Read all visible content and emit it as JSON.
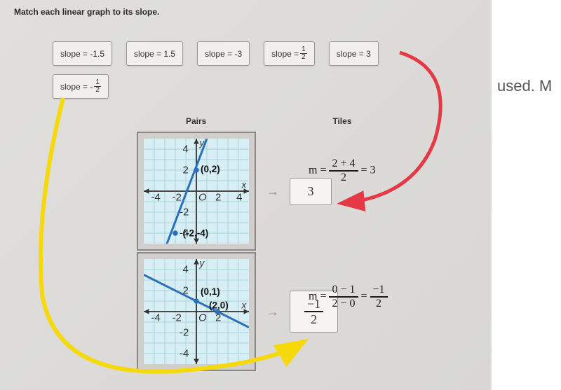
{
  "instruction": "Match each linear graph to its slope.",
  "tiles": {
    "t1": "slope = -1.5",
    "t2": "slope = 1.5",
    "t3": "slope = -3",
    "t4_prefix": "slope = ",
    "t4_num": "1",
    "t4_den": "2",
    "t5": "slope = 3",
    "t6_prefix": "slope = -",
    "t6_num": "1",
    "t6_den": "2"
  },
  "headers": {
    "pairs": "Pairs",
    "tiles": "Tiles"
  },
  "graph1": {
    "pt1": "(0,2)",
    "pt2": "(-2,-4)",
    "ylabel": "y",
    "xlabel": "x"
  },
  "graph2": {
    "pt1": "(0,1)",
    "pt2": "(2,0)",
    "ylabel": "y",
    "xlabel": "x"
  },
  "handwriting": {
    "eq1_lhs": "m =",
    "eq1_num": "2 + 4",
    "eq1_den": "2",
    "eq1_result": "= 3",
    "eq2_lhs": "m =",
    "eq2_num": "0 − 1",
    "eq2_den": "2 − 0",
    "eq2_eq": "=",
    "eq2_rnum": "−1",
    "eq2_rden": "2"
  },
  "answers": {
    "a1": "3",
    "a2_num": "−1",
    "a2_den": "2"
  },
  "rightPanel": "used. M",
  "axis": {
    "n4": "-4",
    "n2": "-2",
    "p2": "2",
    "p4": "4",
    "origin": "O"
  }
}
